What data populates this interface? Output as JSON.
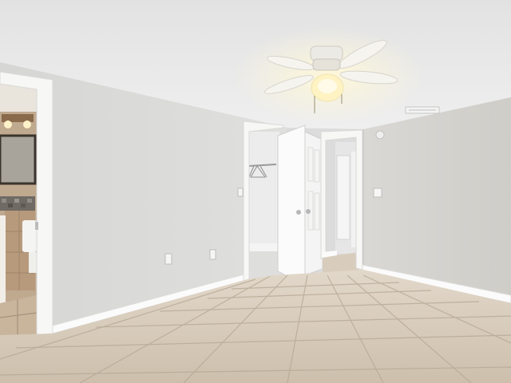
{
  "palette": {
    "ceiling": "#e9e9e9",
    "wall_left": "#d8d8d6",
    "wall_right": "#d2d1cc",
    "trim": "#ffffff",
    "floor_tile": "#d4c6b4",
    "grout": "#a59a8a",
    "bathroom_wall": "#b8a187",
    "closet_interior": "#ececec",
    "fan_light": "#fff3c4",
    "fan_blade": "#f6f4ef"
  }
}
